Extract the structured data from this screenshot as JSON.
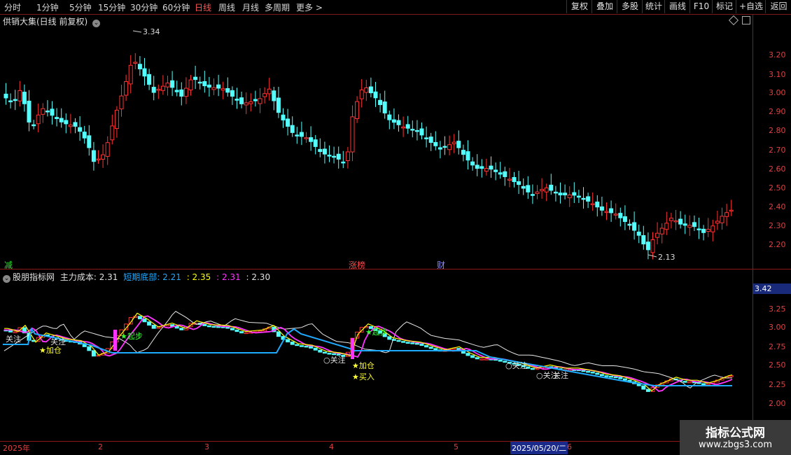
{
  "toolbar": {
    "periods": [
      "分时",
      "1分钟",
      "5分钟",
      "15分钟",
      "30分钟",
      "60分钟",
      "日线",
      "周线",
      "月线",
      "多周期",
      "更多 >"
    ],
    "active_period": "日线",
    "buttons": [
      "复权",
      "叠加",
      "多股",
      "统计",
      "画线",
      "F10",
      "标记",
      "+自选",
      "返回"
    ]
  },
  "main_chart": {
    "title": "供销大集(日线 前复权)",
    "price_labels": [
      "3.20",
      "3.10",
      "3.00",
      "2.90",
      "2.80",
      "2.70",
      "2.60",
      "2.50",
      "2.40",
      "2.30",
      "2.20"
    ],
    "high_marker": "3.34",
    "low_marker": "2.13",
    "event_markers": [
      {
        "text": "减",
        "color": "#33dd33"
      },
      {
        "text": "涨榜",
        "color": "#ff4444"
      },
      {
        "text": "财",
        "color": "#8888ff"
      }
    ]
  },
  "indicator": {
    "name": "股朋指标网",
    "main_cost_label": "主力成本:",
    "main_cost_value": "2.31",
    "short_bottom_label": "短期底部:",
    "short_bottom_value": "2.21",
    "v1": ": 2.35",
    "v2": ": 2.31",
    "v3": ": 2.30",
    "top_box": "3.42",
    "price_labels": [
      "3.25",
      "3.00",
      "2.75",
      "2.50",
      "2.25",
      "2.00"
    ],
    "signals": [
      "关注",
      "关注",
      "加仓",
      "起步",
      "关注",
      "加仓",
      "买入",
      "起步",
      "关注",
      "关注",
      "关注"
    ]
  },
  "date_axis": {
    "labels": [
      "2025年",
      "2",
      "3",
      "4",
      "5",
      "6"
    ],
    "cursor_date": "2025/05/20/二"
  },
  "watermark": {
    "line1": "指标公式网",
    "line2": "www.zbgs3.com"
  },
  "colors": {
    "up": "#ff3333",
    "down": "#54ffff",
    "border": "#8a1a1a",
    "blue_line": "#1eaaff",
    "magenta": "#ff33ff",
    "yellow": "#ffff00",
    "white": "#e8e8e8"
  }
}
